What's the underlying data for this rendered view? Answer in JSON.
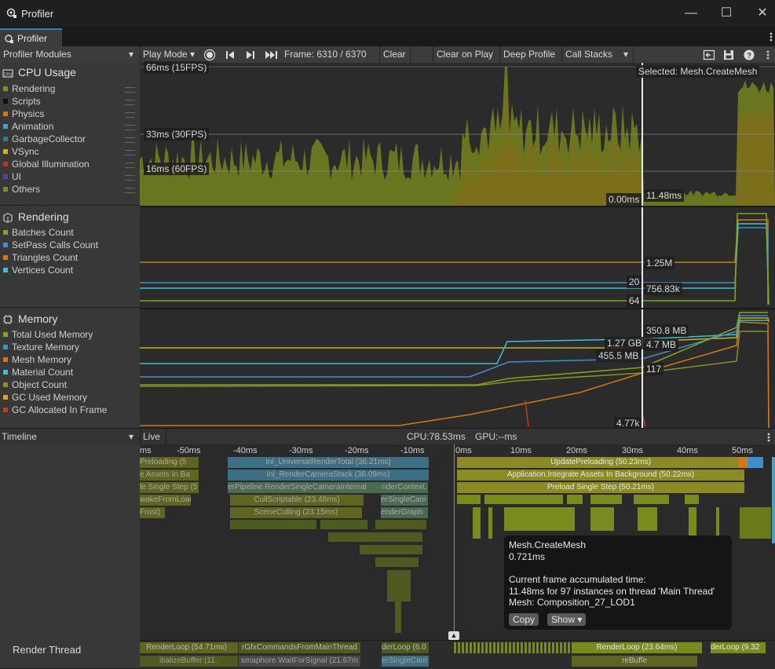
{
  "window": {
    "title": "Profiler",
    "minimize": "—",
    "maximize": "☐",
    "close": "✕"
  },
  "tab": {
    "label": "Profiler"
  },
  "toolbar": {
    "modules_dropdown": "Profiler Modules",
    "play_mode": "Play Mode",
    "frame_label": "Frame: 6310 / 6370",
    "clear": "Clear",
    "clear_on_play": "Clear on Play",
    "deep_profile": "Deep Profile",
    "call_stacks": "Call Stacks"
  },
  "modules": {
    "cpu": {
      "title": "CPU Usage",
      "items": [
        {
          "label": "Rendering",
          "color": "#6a9b1e"
        },
        {
          "label": "Scripts",
          "color": "#101010"
        },
        {
          "label": "Physics",
          "color": "#d07a17"
        },
        {
          "label": "Animation",
          "color": "#3fa4c7"
        },
        {
          "label": "GarbageCollector",
          "color": "#2e7f8a"
        },
        {
          "label": "VSync",
          "color": "#c9b31f"
        },
        {
          "label": "Global Illumination",
          "color": "#b5371f"
        },
        {
          "label": "UI",
          "color": "#5a3f9b"
        },
        {
          "label": "Others",
          "color": "#7f8a26"
        }
      ],
      "labels": {
        "l66": "66ms (15FPS)",
        "l33": "33ms (30FPS)",
        "l16": "16ms (60FPS)",
        "selected": "Selected: Mesh.CreateMesh",
        "zero": "0.00ms",
        "value": "11.48ms"
      }
    },
    "rendering": {
      "title": "Rendering",
      "items": [
        {
          "label": "Batches Count",
          "color": "#7fa81d"
        },
        {
          "label": "SetPass Calls Count",
          "color": "#3d8fcf"
        },
        {
          "label": "Triangles Count",
          "color": "#d07a17"
        },
        {
          "label": "Vertices Count",
          "color": "#3fbfcf"
        }
      ],
      "labels": {
        "tri": "1.25M",
        "set": "20",
        "vert": "756.83k",
        "batch": "64"
      }
    },
    "memory": {
      "title": "Memory",
      "items": [
        {
          "label": "Total Used Memory",
          "color": "#7fa81d"
        },
        {
          "label": "Texture Memory",
          "color": "#3d8fcf"
        },
        {
          "label": "Mesh Memory",
          "color": "#d07a17"
        },
        {
          "label": "Material Count",
          "color": "#3fbfcf"
        },
        {
          "label": "Object Count",
          "color": "#8a8f2a"
        },
        {
          "label": "GC Used Memory",
          "color": "#d8a21c"
        },
        {
          "label": "GC Allocated In Frame",
          "color": "#c23a1f"
        }
      ],
      "labels": {
        "total": "1.27 GB",
        "gc": "350.8 MB",
        "tex": "455.5 MB",
        "mesh": "4.7 MB",
        "mat": "117",
        "alloc": "4.77k"
      }
    }
  },
  "timeline": {
    "dropdown": "Timeline",
    "live": "Live",
    "cpu": "CPU:78.53ms",
    "gpu": "GPU:--ms",
    "ticks": [
      "ms",
      "-50ms",
      "-40ms",
      "-30ms",
      "-20ms",
      "-10ms",
      "0ms",
      "10ms",
      "20ms",
      "30ms",
      "40ms",
      "50ms"
    ],
    "bars_left": [
      "Preloading (5",
      "Inl_UniversalRenderTotal (36.21ms)",
      "e Assets In Ba",
      "Inl_RenderCameraStack (36.09ms)",
      "le Single Step (5",
      "erPipeline.RenderSingleCameraInternal",
      "nderContext.",
      "wakeFromLoad",
      "CullScriptable (23.48ms)",
      "erSingleCam",
      "Frost)",
      "SceneCulling (23.15ms)",
      "enderGraph"
    ],
    "bars_right": [
      "UpdatePreloading (50.23ms)",
      "Application.Integrate Assets In Background (50.22ms)",
      "Preload Single Step (50.21ms)"
    ],
    "render_thread": "Render Thread",
    "render_bars": [
      "RenderLoop (54.71ms)",
      "rGfxCommandsFromMainThread",
      "derLoop (6.0",
      "RenderLoop (23.64ms)",
      "derLoop (9.32",
      "itializeBuffer (11.",
      "smaphore.WaitForSignal (21.67m",
      "erSingleCam",
      "reBuffe"
    ]
  },
  "tooltip": {
    "name": "Mesh.CreateMesh",
    "time": "0.721ms",
    "acc_title": "Current frame accumulated time:",
    "acc_detail": "11.48ms for 97 instances on thread 'Main Thread'",
    "mesh": "Mesh: Composition_27_LOD1",
    "copy": "Copy",
    "show": "Show"
  }
}
